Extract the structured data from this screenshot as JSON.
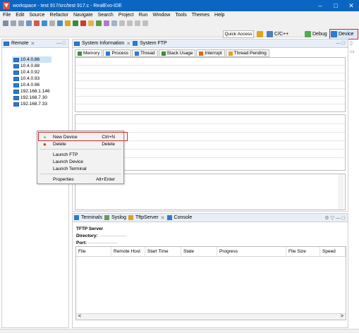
{
  "window": {
    "title": "workspace - test 917/src/test 917.c - RealEvo-IDE",
    "minimize": "–",
    "maximize": "□",
    "close": "✕"
  },
  "menu": [
    "File",
    "Edit",
    "Source",
    "Refactor",
    "Navigate",
    "Search",
    "Project",
    "Run",
    "Window",
    "Tools",
    "Themes",
    "Help"
  ],
  "toolbar": {
    "quick_access": "Quick Access",
    "perspectives": [
      "C/C++",
      "Debug",
      "Device"
    ]
  },
  "remote": {
    "tab_label": "Remote",
    "tab_close": "✕",
    "devices": [
      "10.4.0.86",
      "10.4.0.88",
      "10.4.0.92",
      "10.4.0.93",
      "10.4.0.96",
      "192.168.1.146",
      "192.168.7.30",
      "192.168.7.33"
    ]
  },
  "sysinfo": {
    "tabs": [
      "System Information",
      "System FTP"
    ],
    "subtabs": [
      "Memory",
      "Process",
      "Thread",
      "Stack Usage",
      "Interrupt",
      "Thread Pending"
    ]
  },
  "context_menu": {
    "items": [
      {
        "label": "New Device",
        "shortcut": "Ctrl+N",
        "icon": "+"
      },
      {
        "label": "Delete",
        "shortcut": "Delete",
        "icon": "●"
      },
      {
        "label": "Launch FTP",
        "shortcut": ""
      },
      {
        "label": "Launch Device",
        "shortcut": ""
      },
      {
        "label": "Launch Terminal",
        "shortcut": ""
      },
      {
        "label": "Properties",
        "shortcut": "Alt+Enter"
      }
    ]
  },
  "bottom": {
    "tabs": [
      "Terminals",
      "Syslog",
      "TftpServer",
      "Console"
    ],
    "server_title": "TFTP Server",
    "directory_label": "Directory:",
    "directory_value": "------------------",
    "port_label": "Port:",
    "port_value": "-------------------",
    "columns": [
      "File",
      "Remote Host",
      "Start Time",
      "State",
      "Progress",
      "File Size",
      "Speed"
    ],
    "scroll_left": "<",
    "scroll_right": ">"
  },
  "colors": {
    "titlebar": "#0a66c2",
    "highlight": "#d9292b",
    "selection": "#cce4f7"
  }
}
